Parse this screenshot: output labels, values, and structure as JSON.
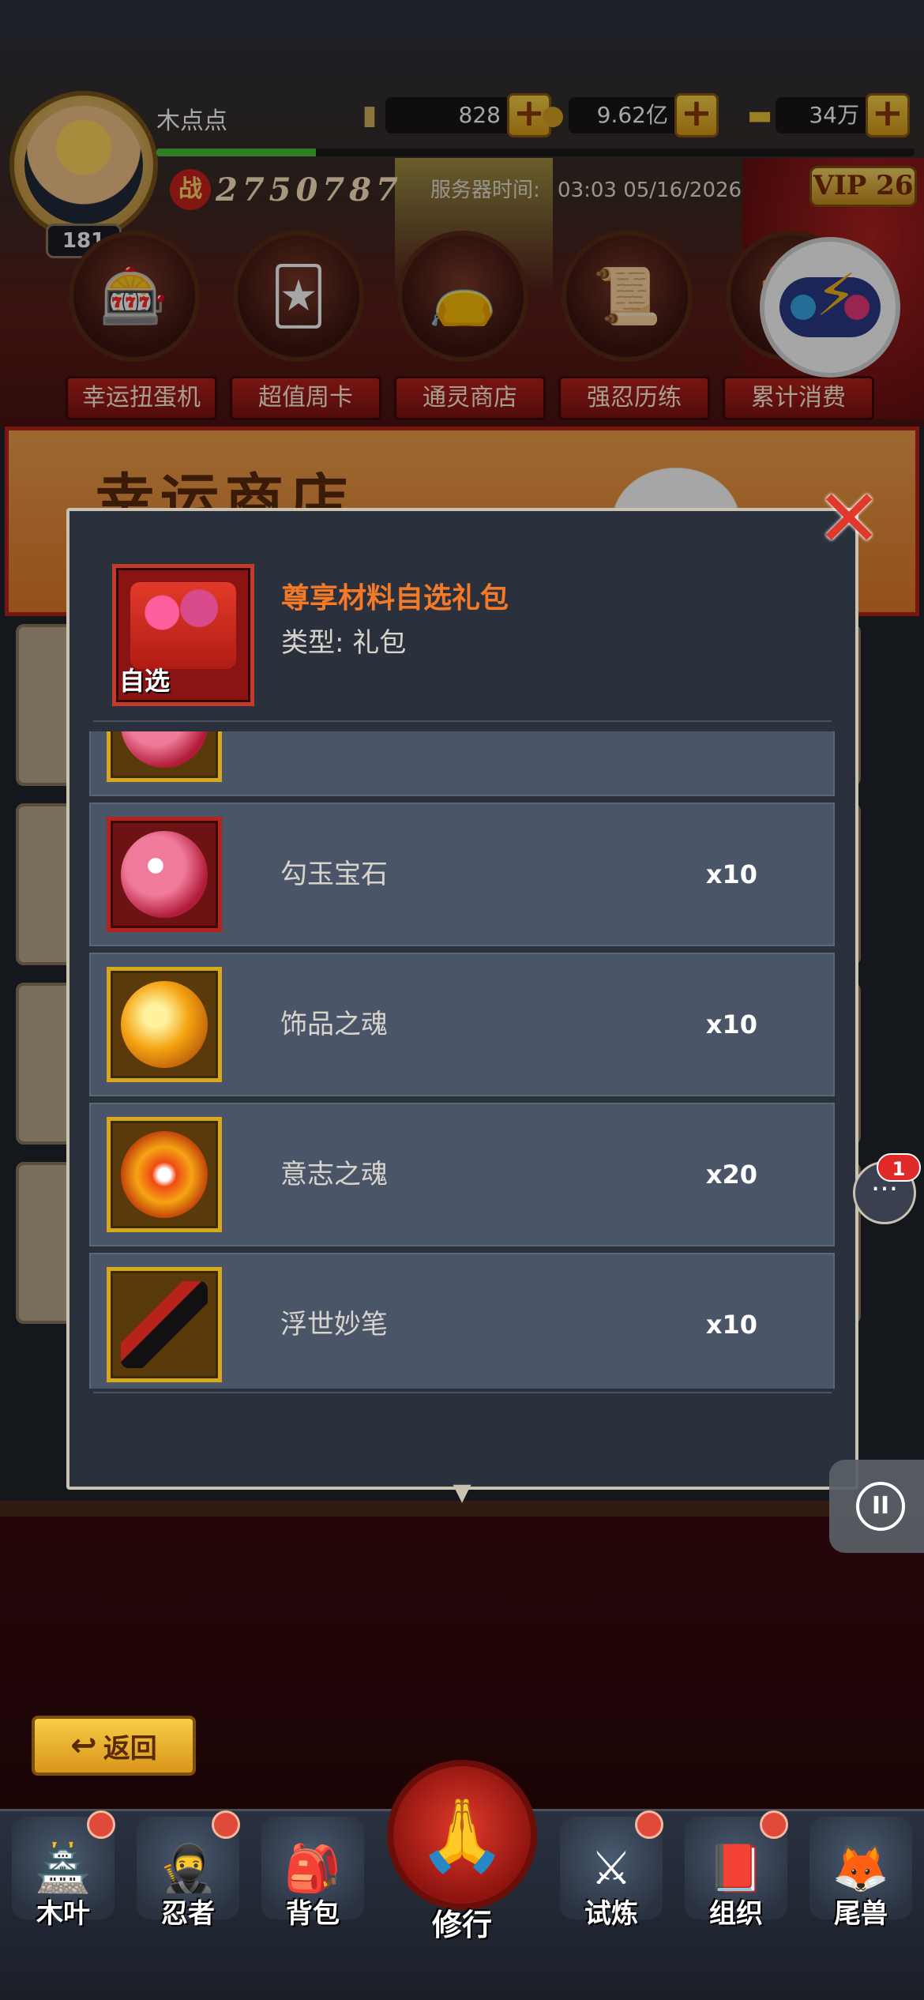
{
  "header": {
    "player_name": "木点点",
    "level": "181",
    "exp_fraction": 0.21,
    "resources": [
      {
        "icon": "scroll-ticket-icon",
        "value": "828"
      },
      {
        "icon": "coin-icon",
        "value": "9.62亿"
      },
      {
        "icon": "gold-bar-icon",
        "value": "34万"
      }
    ],
    "power": "2750787",
    "power_icon_text": "战",
    "server_time_label": "服务器时间:",
    "server_time": "03:03 05/16/2026",
    "vip": "VIP 26"
  },
  "events": [
    {
      "label": "幸运扭蛋机",
      "icon": "gacha-machine-icon"
    },
    {
      "label": "超值周卡",
      "icon": "weekly-card-icon"
    },
    {
      "label": "通灵商店",
      "icon": "lucky-bag-icon"
    },
    {
      "label": "强忍历练",
      "icon": "scroll-training-icon"
    },
    {
      "label": "累计消费",
      "icon": "gift-box-icon"
    }
  ],
  "banner": {
    "title": "幸运商店"
  },
  "modal": {
    "gift_name": "尊享材料自选礼包",
    "gift_type": "类型: 礼包",
    "gift_tag": "自选",
    "items": [
      {
        "name": "",
        "qty": "",
        "icon": "gem-icon",
        "frame": "gold"
      },
      {
        "name": "勾玉宝石",
        "qty": "x10",
        "icon": "magatama-gem-icon",
        "frame": "red"
      },
      {
        "name": "饰品之魂",
        "qty": "x10",
        "icon": "accessory-soul-icon",
        "frame": "gold"
      },
      {
        "name": "意志之魂",
        "qty": "x20",
        "icon": "will-soul-icon",
        "frame": "gold"
      },
      {
        "name": "浮世妙笔",
        "qty": "x10",
        "icon": "ink-brush-icon",
        "frame": "gold"
      }
    ]
  },
  "chat": {
    "badge": "1"
  },
  "back_label": "返回",
  "nav": [
    {
      "label": "木叶",
      "icon": "konoha-icon",
      "dot": true
    },
    {
      "label": "忍者",
      "icon": "ninja-icon",
      "dot": true
    },
    {
      "label": "背包",
      "icon": "backpack-icon",
      "dot": false
    },
    {
      "label": "修行",
      "icon": "training-hands-icon",
      "dot": false
    },
    {
      "label": "试炼",
      "icon": "trial-icon",
      "dot": true
    },
    {
      "label": "组织",
      "icon": "organization-icon",
      "dot": true
    },
    {
      "label": "尾兽",
      "icon": "tailed-beast-icon",
      "dot": false
    }
  ]
}
